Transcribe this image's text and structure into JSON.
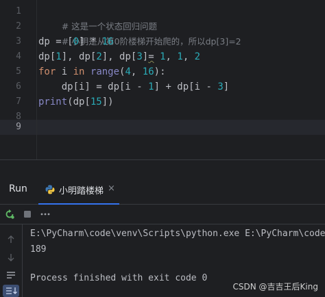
{
  "editor": {
    "line_numbers": [
      "1",
      "2",
      "3",
      "4",
      "5",
      "6",
      "7",
      "8",
      "9"
    ],
    "line1_comment": "# 这是一个状态回归问题",
    "line2_comment": "# 小明是从第0阶楼梯开始爬的，所以dp[3]=2",
    "line3": {
      "lhs": "dp = [",
      "n0": "0",
      "mid": "] * ",
      "n16": "16"
    },
    "line4": {
      "lhs": "dp[",
      "i1": "1",
      "a": "], dp[",
      "i2": "2",
      "b": "], dp[",
      "i3": "3",
      "c": "]",
      "eq": "=",
      "sp": " ",
      "v1": "1",
      "cm1": ", ",
      "v2": "1",
      "cm2": ", ",
      "v3": "2"
    },
    "line5": {
      "kw_for": "for",
      "i": " i ",
      "kw_in": "in",
      "sp": " ",
      "fn_range": "range",
      "open": "(",
      "n4": "4",
      "comma": ", ",
      "n16": "16",
      "close": "):"
    },
    "line6": {
      "a": "    dp[i] = dp[i - ",
      "n1": "1",
      "b": "] + dp[i - ",
      "n3": "3",
      "c": "]"
    },
    "line7": {
      "fn_print": "print",
      "a": "(dp[",
      "n15": "15",
      "b": "])"
    }
  },
  "tool_window": {
    "title": "Run",
    "tab_label": "小明踏楼梯",
    "tab_close": "×"
  },
  "console": {
    "command": "E:\\PyCharm\\code\\venv\\Scripts\\python.exe E:\\PyCharm\\code\\",
    "output": "189",
    "exit_message": "Process finished with exit code 0"
  },
  "watermark": "CSDN @吉吉王后King",
  "icons": {
    "rerun": "rerun-icon",
    "stop": "stop-icon",
    "more": "more-icon",
    "up": "arrow-up-icon",
    "down": "arrow-down-icon",
    "soft_wrap": "soft-wrap-icon",
    "scroll_end": "scroll-to-end-icon",
    "python": "python-icon"
  },
  "colors": {
    "background": "#1e1f22",
    "comment": "#7a7e85",
    "number": "#2aacb8",
    "keyword": "#cf8e6d",
    "builtin": "#8888c6",
    "text": "#bcbec4",
    "accent": "#3574f0"
  }
}
